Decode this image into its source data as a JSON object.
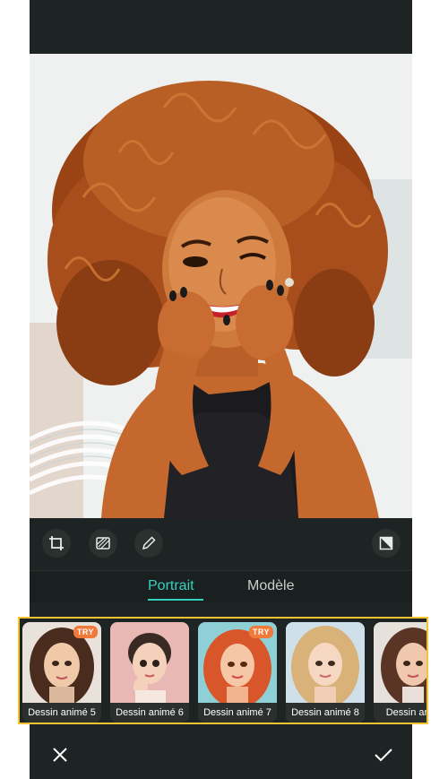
{
  "tabs": [
    {
      "label": "Portrait",
      "active": true
    },
    {
      "label": "Modèle",
      "active": false
    }
  ],
  "styles": [
    {
      "label": "Dessin animé 5",
      "badge": "TRY"
    },
    {
      "label": "Dessin animé 6",
      "badge": ""
    },
    {
      "label": "Dessin animé 7",
      "badge": "TRY"
    },
    {
      "label": "Dessin animé 8",
      "badge": "",
      "selected": true
    },
    {
      "label": "Dessin anim",
      "badge": ""
    }
  ],
  "toolbar": {
    "icons": [
      "crop-icon",
      "texture-icon",
      "pencil-icon",
      "compare-icon"
    ]
  },
  "colors": {
    "accent": "#35d1c0",
    "highlight_border": "#f4c430",
    "badge": "#f07a3a"
  }
}
